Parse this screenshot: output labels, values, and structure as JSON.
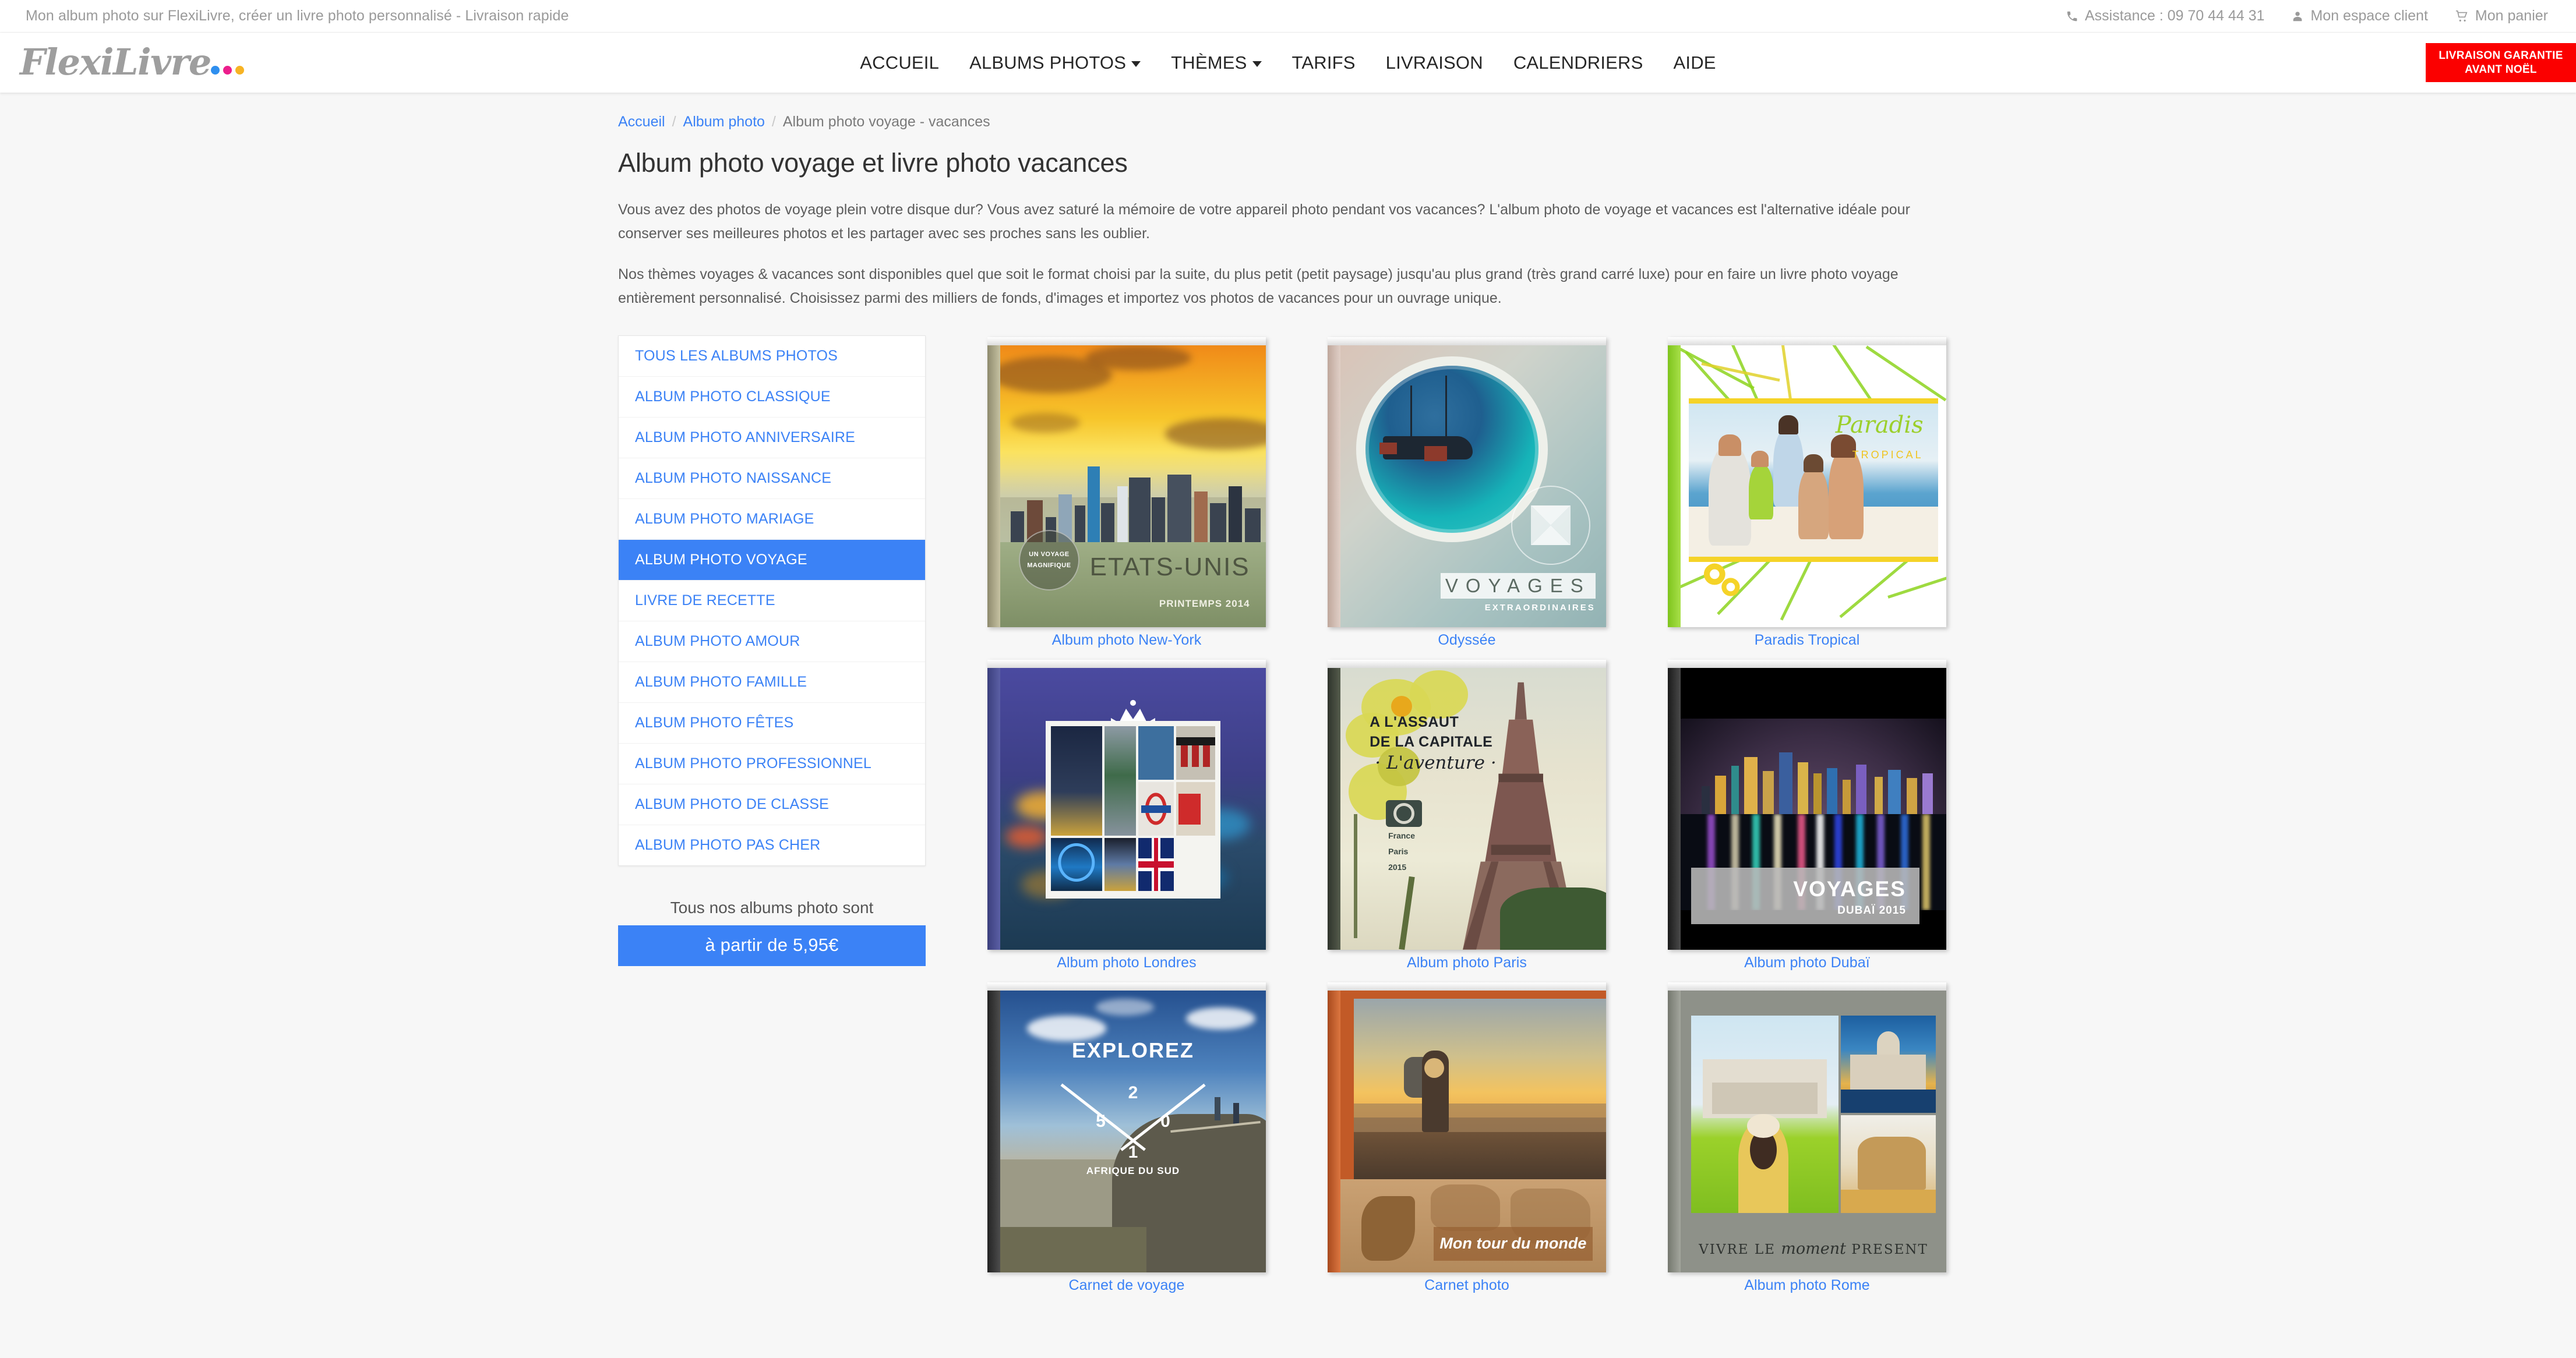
{
  "topbar": {
    "tagline": "Mon album photo sur FlexiLivre, créer un livre photo personnalisé - Livraison rapide",
    "links": [
      {
        "icon": "phone-icon",
        "label": "Assistance : 09 70 44 44 31"
      },
      {
        "icon": "user-icon",
        "label": "Mon espace client"
      },
      {
        "icon": "cart-icon",
        "label": "Mon panier"
      }
    ]
  },
  "header": {
    "logo_text": "FlexiLivre",
    "logo_dot_colors": [
      "#2f8fef",
      "#ec1e8c",
      "#f7b324"
    ],
    "nav": [
      {
        "label": "ACCUEIL",
        "has_caret": false
      },
      {
        "label": "ALBUMS PHOTOS",
        "has_caret": true
      },
      {
        "label": "THÈMES",
        "has_caret": true
      },
      {
        "label": "TARIFS",
        "has_caret": false
      },
      {
        "label": "LIVRAISON",
        "has_caret": false
      },
      {
        "label": "CALENDRIERS",
        "has_caret": false
      },
      {
        "label": "AIDE",
        "has_caret": false
      }
    ],
    "badge_line1": "LIVRAISON GARANTIE",
    "badge_line2": "AVANT NOËL",
    "badge_color": "#fb0000"
  },
  "breadcrumb": {
    "home": "Accueil",
    "parent": "Album photo",
    "current": "Album photo voyage - vacances",
    "separator": "/"
  },
  "main": {
    "title": "Album photo voyage et livre photo vacances",
    "paragraph1": "Vous avez des photos de voyage plein votre disque dur? Vous avez saturé la mémoire de votre appareil photo pendant vos vacances? L'album photo de voyage et vacances est l'alternative idéale pour conserver ses meilleures photos et les partager avec ses proches sans les oublier.",
    "paragraph2": "Nos thèmes voyages & vacances sont disponibles quel que soit le format choisi par la suite, du plus petit (petit paysage) jusqu'au plus grand (très grand carré luxe) pour en faire un livre photo voyage entièrement personnalisé. Choisissez parmi des milliers de fonds, d'images et importez vos photos de vacances pour un ouvrage unique."
  },
  "sidebar": {
    "categories": [
      {
        "label": "TOUS LES ALBUMS PHOTOS",
        "active": false
      },
      {
        "label": "ALBUM PHOTO CLASSIQUE",
        "active": false
      },
      {
        "label": "ALBUM PHOTO ANNIVERSAIRE",
        "active": false
      },
      {
        "label": "ALBUM PHOTO NAISSANCE",
        "active": false
      },
      {
        "label": "ALBUM PHOTO MARIAGE",
        "active": false
      },
      {
        "label": "ALBUM PHOTO VOYAGE",
        "active": true
      },
      {
        "label": "LIVRE DE RECETTE",
        "active": false
      },
      {
        "label": "ALBUM PHOTO AMOUR",
        "active": false
      },
      {
        "label": "ALBUM PHOTO FAMILLE",
        "active": false
      },
      {
        "label": "ALBUM PHOTO FÊTES",
        "active": false
      },
      {
        "label": "ALBUM PHOTO PROFESSIONNEL",
        "active": false
      },
      {
        "label": "ALBUM PHOTO DE CLASSE",
        "active": false
      },
      {
        "label": "ALBUM PHOTO PAS CHER",
        "active": false
      }
    ],
    "price_label": "Tous nos albums photo sont",
    "price_button": "à partir de 5,95€",
    "accent_color": "#3b82f6"
  },
  "products": [
    {
      "title": "Album photo New-York",
      "cover_title": "ETATS-UNIS",
      "cover_subtitle": "PRINTEMPS 2014",
      "cover_stamp_line1": "UN VOYAGE",
      "cover_stamp_line2": "MAGNIFIQUE"
    },
    {
      "title": "Odyssée",
      "cover_title": "VOYAGES",
      "cover_subtitle": "EXTRAORDINAIRES"
    },
    {
      "title": "Paradis Tropical",
      "cover_title": "Paradis",
      "cover_subtitle": "TROPICAL"
    },
    {
      "title": "Album photo Londres",
      "cover_title": "",
      "cover_subtitle": ""
    },
    {
      "title": "Album photo Paris",
      "cover_title": "A L'ASSAUT\nDE LA CAPITALE",
      "cover_script": "· L'aventure ·",
      "cover_location": "France\nParis\n2015"
    },
    {
      "title": "Album photo Dubaï",
      "cover_title": "VOYAGES",
      "cover_subtitle": "DUBAÏ 2015"
    },
    {
      "title": "Carnet de voyage",
      "cover_title": "EXPLOREZ",
      "cover_year_digits": [
        "2",
        "5",
        "0",
        "1"
      ],
      "cover_subtitle": "AFRIQUE DU SUD"
    },
    {
      "title": "Carnet photo",
      "cover_title": "Mon tour du monde"
    },
    {
      "title": "Album photo Rome",
      "cover_caption_pre": "VIVRE LE",
      "cover_caption_script": "moment",
      "cover_caption_post": "PRESENT"
    }
  ]
}
